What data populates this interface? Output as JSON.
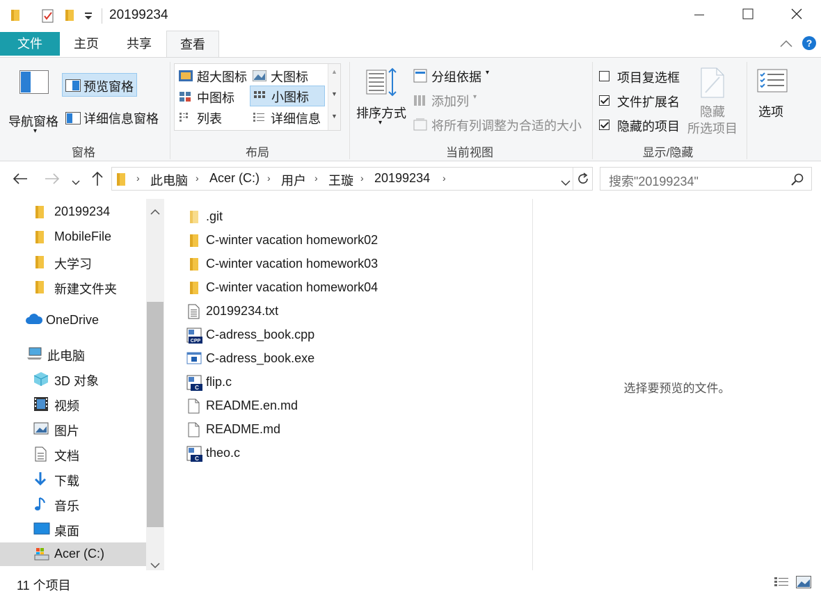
{
  "window": {
    "title": "20199234"
  },
  "tabs": [
    {
      "label": "文件"
    },
    {
      "label": "主页"
    },
    {
      "label": "共享"
    },
    {
      "label": "查看"
    }
  ],
  "ribbon": {
    "panes": {
      "nav_pane": "导航窗格",
      "preview_pane": "预览窗格",
      "details_pane": "详细信息窗格",
      "group_label": "窗格"
    },
    "layout": {
      "extra_large": "超大图标",
      "large": "大图标",
      "medium": "中图标",
      "small": "小图标",
      "list": "列表",
      "details": "详细信息",
      "group_label": "布局"
    },
    "current_view": {
      "sort_by": "排序方式",
      "group_by": "分组依据",
      "add_columns": "添加列",
      "size_all_columns": "将所有列调整为合适的大小",
      "group_label": "当前视图"
    },
    "show_hide": {
      "item_checkboxes": {
        "label": "项目复选框",
        "checked": false
      },
      "file_extensions": {
        "label": "文件扩展名",
        "checked": true
      },
      "hidden_items": {
        "label": "隐藏的项目",
        "checked": true
      },
      "hide_selected_1": "隐藏",
      "hide_selected_2": "所选项目",
      "group_label": "显示/隐藏"
    },
    "options": "选项"
  },
  "address": {
    "crumbs": [
      "此电脑",
      "Acer (C:)",
      "用户",
      "王璇",
      "20199234"
    ],
    "search_placeholder": "搜索\"20199234\""
  },
  "nav_pane": {
    "items": [
      {
        "label": "20199234",
        "icon": "folder-icon"
      },
      {
        "label": "MobileFile",
        "icon": "folder-icon"
      },
      {
        "label": "大学习",
        "icon": "folder-icon"
      },
      {
        "label": "新建文件夹",
        "icon": "folder-icon"
      },
      {
        "label": "OneDrive",
        "icon": "cloud-icon"
      },
      {
        "label": "此电脑",
        "icon": "computer-icon"
      },
      {
        "label": "3D 对象",
        "icon": "cube-icon"
      },
      {
        "label": "视频",
        "icon": "video-icon"
      },
      {
        "label": "图片",
        "icon": "picture-icon"
      },
      {
        "label": "文档",
        "icon": "document-icon"
      },
      {
        "label": "下载",
        "icon": "download-icon"
      },
      {
        "label": "音乐",
        "icon": "music-icon"
      },
      {
        "label": "桌面",
        "icon": "desktop-icon"
      },
      {
        "label": "Acer (C:)",
        "icon": "drive-icon"
      }
    ]
  },
  "files": [
    {
      "name": ".git",
      "type": "folder-faded"
    },
    {
      "name": "C-winter vacation homework02",
      "type": "folder"
    },
    {
      "name": "C-winter vacation homework03",
      "type": "folder"
    },
    {
      "name": "C-winter vacation homework04",
      "type": "folder"
    },
    {
      "name": "20199234.txt",
      "type": "txt"
    },
    {
      "name": "C-adress_book.cpp",
      "type": "cpp"
    },
    {
      "name": "C-adress_book.exe",
      "type": "exe"
    },
    {
      "name": "flip.c",
      "type": "c"
    },
    {
      "name": "README.en.md",
      "type": "blank"
    },
    {
      "name": "README.md",
      "type": "blank"
    },
    {
      "name": "theo.c",
      "type": "c"
    }
  ],
  "preview": {
    "message": "选择要预览的文件。"
  },
  "status": {
    "count": "11 个项目"
  },
  "colors": {
    "file_tab": "#1a9dab",
    "accent": "#0078d7",
    "folder": "#f3c343",
    "selection": "#cce4f7"
  }
}
